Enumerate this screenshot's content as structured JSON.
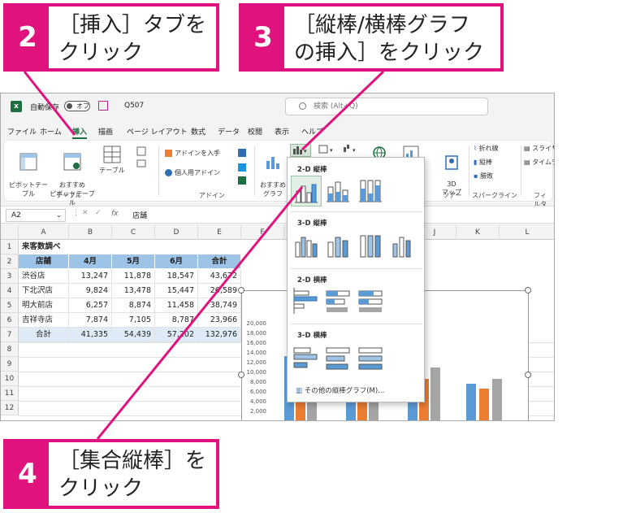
{
  "callouts": [
    {
      "num": "2",
      "text": "［挿入］タブを\nクリック"
    },
    {
      "num": "3",
      "text": "［縦棒/横棒グラフ\nの挿入］をクリック"
    },
    {
      "num": "4",
      "text": "［集合縦棒］を\nクリック"
    }
  ],
  "titlebar": {
    "autosave": "自動保存",
    "toggle": "オフ",
    "filename": "Q507",
    "search": "検索 (Alt+Q)"
  },
  "tabs": [
    "ファイル",
    "ホーム",
    "挿入",
    "描画",
    "ページ レイアウト",
    "数式",
    "データ",
    "校閲",
    "表示",
    "ヘルプ"
  ],
  "active_tab": "挿入",
  "ribbon": {
    "pivot": "ピボットテー\nブル",
    "rec_pivot": "おすすめ\nピボットテーブル",
    "table": "テーブル",
    "group_table": "テーブル",
    "addin_get": "アドインを入手",
    "addin_mine": "個人用アドイン",
    "group_addin": "アドイン",
    "rec_chart": "おすすめ\nグラフ",
    "map3d": "3D\nマップ",
    "group_tour": "ツアー",
    "spark_line": "折れ線",
    "spark_col": "縦棒",
    "spark_wl": "勝敗",
    "group_spark": "スパークライン",
    "slicer": "スライサー",
    "timeline": "タイムライン",
    "group_filter": "フィルター"
  },
  "formula": {
    "namebox": "A2",
    "fx": "fx",
    "value": "店舗"
  },
  "columns": [
    "A",
    "B",
    "C",
    "D",
    "E",
    "F",
    "G",
    "H",
    "I",
    "J",
    "K",
    "L"
  ],
  "rows": [
    "1",
    "2",
    "3",
    "4",
    "5",
    "6",
    "7",
    "8",
    "9",
    "10",
    "11",
    "12"
  ],
  "sheet": {
    "title": "来客数調べ",
    "headers": [
      "店舗",
      "4月",
      "5月",
      "6月",
      "合計"
    ],
    "data": [
      [
        "渋谷店",
        "13,247",
        "11,878",
        "18,547",
        "43,672"
      ],
      [
        "下北沢店",
        "9,824",
        "13,478",
        "15,447",
        "26,589"
      ],
      [
        "明大前店",
        "6,257",
        "8,874",
        "11,458",
        "38,749"
      ],
      [
        "吉祥寺店",
        "7,874",
        "7,105",
        "8,787",
        "23,966"
      ],
      [
        "合計",
        "41,335",
        "54,439",
        "57,202",
        "132,976"
      ]
    ]
  },
  "chart_yaxis": [
    "20,000",
    "18,000",
    "16,000",
    "14,000",
    "12,000",
    "10,000",
    "8,000",
    "6,000",
    "4,000",
    "2,000"
  ],
  "dropdown": {
    "s1": "2-D 縦棒",
    "s2": "3-D 縦棒",
    "s3": "2-D 横棒",
    "s4": "3-D 横棒",
    "more": "その他の縦棒グラフ(M)..."
  },
  "colors": {
    "accent": "#e0137e",
    "blue": "#5b9bd5",
    "orange": "#ed7d31",
    "gray": "#a5a5a5",
    "excel_green": "#1d6f42"
  }
}
